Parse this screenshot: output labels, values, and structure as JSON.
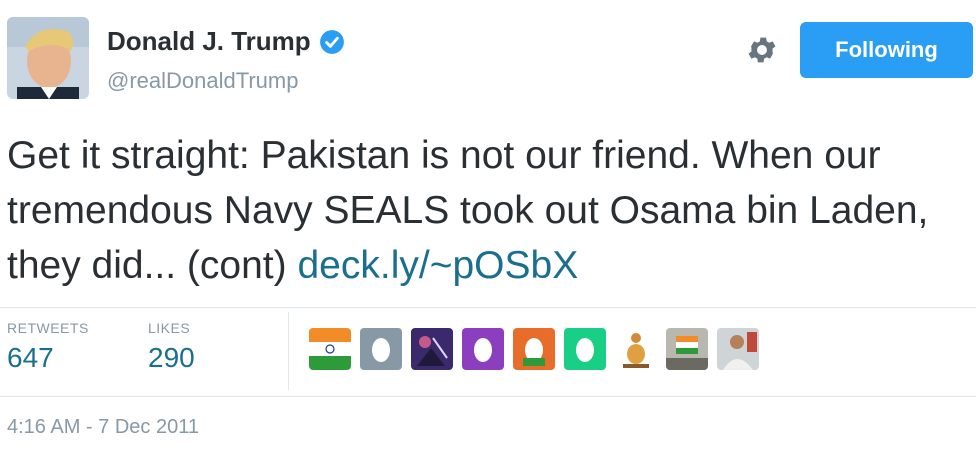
{
  "user": {
    "name": "Donald J. Trump",
    "handle": "@realDonaldTrump"
  },
  "follow_button_label": "Following",
  "tweet": {
    "text": "Get it straight: Pakistan is not our friend. When our tremendous Navy SEALS took out Osama bin Laden, they did... (cont)",
    "link": "deck.ly/~pOSbX"
  },
  "stats": {
    "retweets_label": "RETWEETS",
    "retweets_value": "647",
    "likes_label": "LIKES",
    "likes_value": "290"
  },
  "likers": [
    {
      "icon": "flag-avatar-icon"
    },
    {
      "icon": "egg-avatar-icon",
      "color": "#8899a6"
    },
    {
      "icon": "photo-avatar-icon"
    },
    {
      "icon": "egg-avatar-icon",
      "color": "#8b3fbf"
    },
    {
      "icon": "egg-avatar-icon",
      "color": "#e86d2a"
    },
    {
      "icon": "egg-avatar-icon",
      "color": "#19cf86"
    },
    {
      "icon": "figure-avatar-icon"
    },
    {
      "icon": "flag-photo-avatar-icon"
    },
    {
      "icon": "person-photo-avatar-icon"
    }
  ],
  "timestamp": "4:16 AM - 7 Dec 2011",
  "colors": {
    "accent": "#2a9df4",
    "link": "#1b6f8e",
    "muted": "#8899a6"
  }
}
